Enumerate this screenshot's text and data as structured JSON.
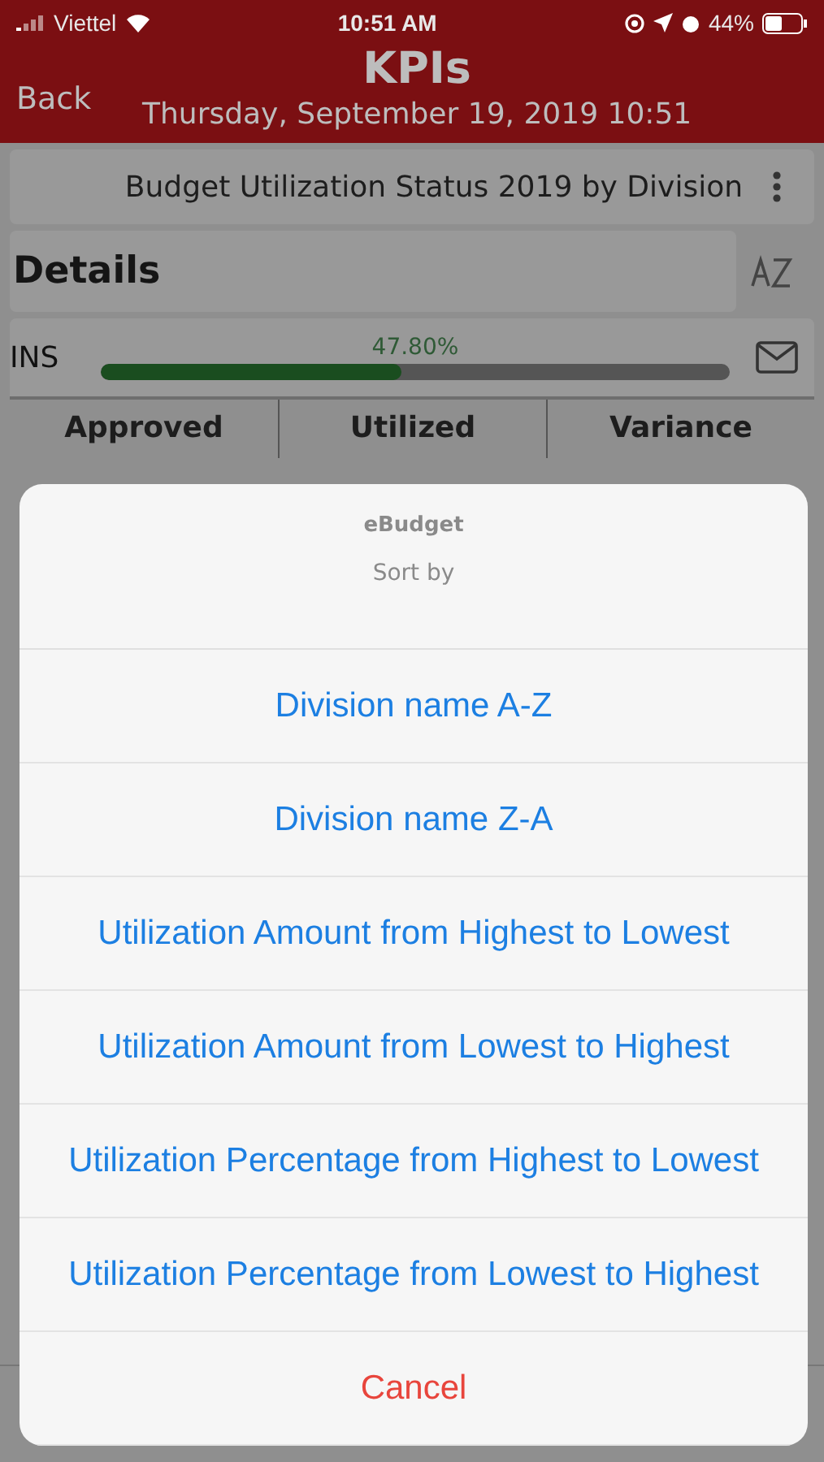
{
  "status_bar": {
    "carrier": "Viettel",
    "time": "10:51 AM",
    "battery": "44%"
  },
  "header": {
    "back": "Back",
    "title": "KPIs",
    "subtitle": "Thursday, September 19, 2019 10:51"
  },
  "report": {
    "title": "Budget Utilization Status 2019 by Division"
  },
  "details": {
    "title": "Details"
  },
  "division": {
    "name": "INS",
    "percent": "47.80%",
    "level": 0.478
  },
  "table": {
    "columns": [
      "Approved",
      "Utilized",
      "Variance"
    ]
  },
  "action_sheet": {
    "title": "eBudget",
    "message": "Sort by",
    "options": [
      {
        "label": "Division name A-Z",
        "kind": "default"
      },
      {
        "label": "Division name Z-A",
        "kind": "default"
      },
      {
        "label": "Utilization Amount from Highest to Lowest",
        "kind": "default"
      },
      {
        "label": "Utilization Amount from Lowest to Highest",
        "kind": "default"
      },
      {
        "label": "Utilization Percentage from Highest to Lowest",
        "kind": "default"
      },
      {
        "label": "Utilization Percentage from Lowest to Highest",
        "kind": "default"
      },
      {
        "label": "Cancel",
        "kind": "cancel"
      }
    ]
  }
}
